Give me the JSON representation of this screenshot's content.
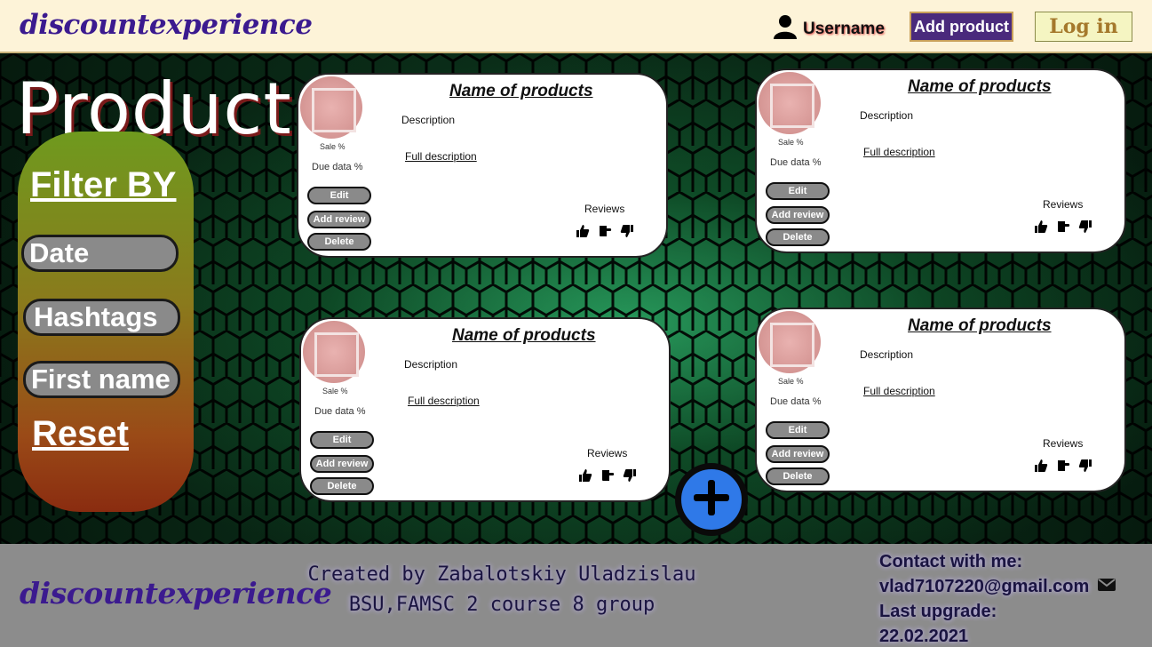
{
  "header": {
    "logo": "discountexperience",
    "username": "Username",
    "add_product": "Add product",
    "login": "Log in"
  },
  "main": {
    "title": "Product",
    "filter": {
      "title": "Filter BY",
      "date": "Date",
      "hashtags": "Hashtags",
      "first_name": "First name",
      "reset": "Reset"
    },
    "cards": [
      {
        "name": "Name of products",
        "description": "Description",
        "full_description": "Full description",
        "sale": "Sale %",
        "due": "Due data %",
        "edit": "Edit",
        "add_review": "Add review",
        "delete": "Delete",
        "reviews": "Reviews"
      },
      {
        "name": "Name of products",
        "description": "Description",
        "full_description": "Full description",
        "sale": "Sale %",
        "due": "Due data %",
        "edit": "Edit",
        "add_review": "Add review",
        "delete": "Delete",
        "reviews": "Reviews"
      },
      {
        "name": "Name of products",
        "description": "Description",
        "full_description": "Full description",
        "sale": "Sale %",
        "due": "Due data %",
        "edit": "Edit",
        "add_review": "Add review",
        "delete": "Delete",
        "reviews": "Reviews"
      },
      {
        "name": "Name of products",
        "description": "Description",
        "full_description": "Full description",
        "sale": "Sale %",
        "due": "Due data %",
        "edit": "Edit",
        "add_review": "Add review",
        "delete": "Delete",
        "reviews": "Reviews"
      }
    ],
    "icons": {
      "like": "thumbs-up-icon",
      "neutral": "point-icon",
      "dislike": "thumbs-down-icon",
      "add": "plus-icon"
    }
  },
  "footer": {
    "logo": "discountexperience",
    "credit_line1": "Created by Zabalotskiy Uladzislau",
    "credit_line2": "BSU,FAMSC 2 course 8 group",
    "contact_label": "Contact with me:",
    "email": "vlad7107220@gmail.com",
    "upgrade_label": "Last upgrade:",
    "upgrade_date": "22.02.2021"
  },
  "colors": {
    "header_bg": "#fdf3d8",
    "logo": "#3b1a8f",
    "add_button": "#4a2a7c",
    "fab": "#2f79e8",
    "footer_bg": "#8c8c8c"
  }
}
